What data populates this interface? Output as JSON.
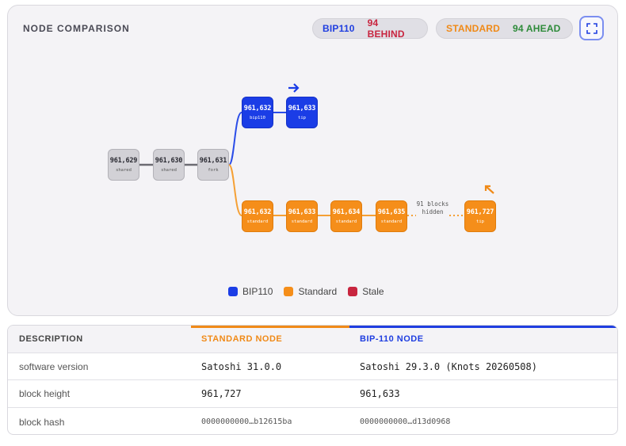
{
  "panel": {
    "title": "NODE COMPARISON",
    "bip_pill": {
      "label": "BIP110",
      "status": "94 BEHIND"
    },
    "std_pill": {
      "label": "STANDARD",
      "status": "94 AHEAD"
    },
    "expand_icon": "expand-icon"
  },
  "chain": {
    "shared": [
      {
        "height": "961,629",
        "tag": "shared"
      },
      {
        "height": "961,630",
        "tag": "shared"
      },
      {
        "height": "961,631",
        "tag": "fork"
      }
    ],
    "bip110": [
      {
        "height": "961,632",
        "tag": "bip110"
      },
      {
        "height": "961,633",
        "tag": "tip"
      }
    ],
    "standard": [
      {
        "height": "961,632",
        "tag": "standard"
      },
      {
        "height": "961,633",
        "tag": "standard"
      },
      {
        "height": "961,634",
        "tag": "standard"
      },
      {
        "height": "961,635",
        "tag": "standard"
      },
      {
        "height": "961,727",
        "tag": "tip"
      }
    ],
    "hidden_label_1": "91 blocks",
    "hidden_label_2": "hidden"
  },
  "legend": [
    {
      "label": "BIP110",
      "color": "#1b3de6"
    },
    {
      "label": "Standard",
      "color": "#f58e1a"
    },
    {
      "label": "Stale",
      "color": "#c8253f"
    }
  ],
  "table": {
    "headers": [
      "DESCRIPTION",
      "STANDARD NODE",
      "BIP-110 NODE"
    ],
    "rows": [
      [
        "software version",
        "Satoshi 31.0.0",
        "Satoshi 29.3.0 (Knots 20260508)"
      ],
      [
        "block height",
        "961,727",
        "961,633"
      ],
      [
        "block hash",
        "0000000000…b12615ba",
        "0000000000…d13d0968"
      ]
    ]
  }
}
